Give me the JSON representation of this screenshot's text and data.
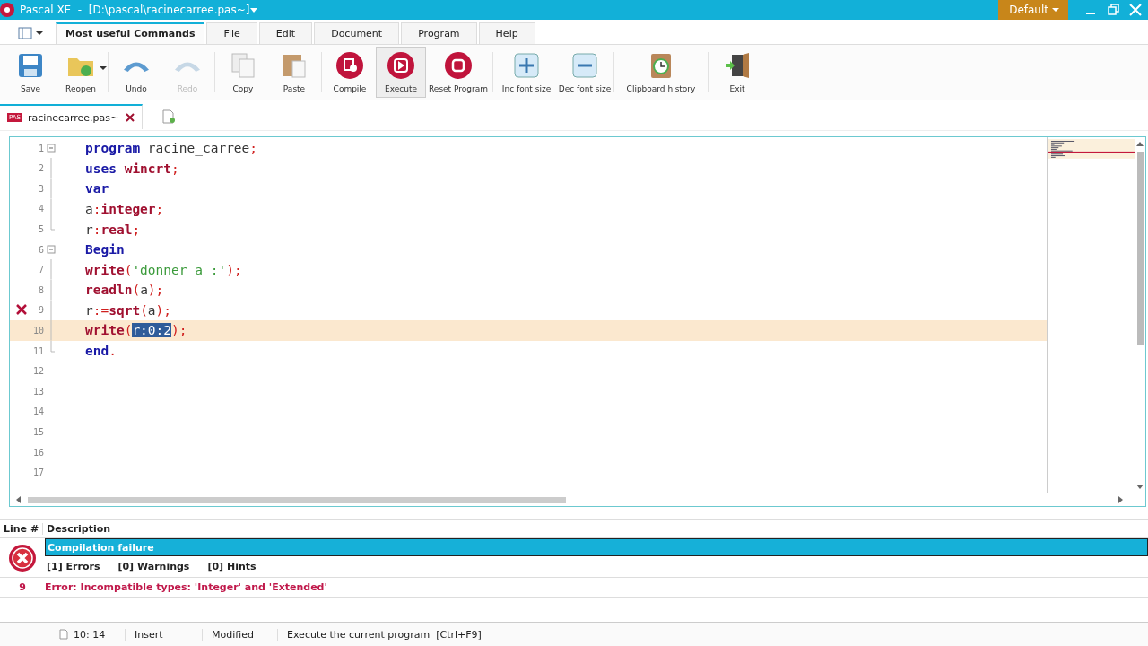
{
  "window": {
    "title": "Pascal XE  -  [D:\\pascal\\racinecarree.pas~]",
    "layout": "Default"
  },
  "ribbon_tabs": [
    {
      "label": "Most useful Commands",
      "selected": true
    },
    {
      "label": "File",
      "selected": false
    },
    {
      "label": "Edit",
      "selected": false
    },
    {
      "label": "Document",
      "selected": false
    },
    {
      "label": "Program",
      "selected": false
    },
    {
      "label": "Help",
      "selected": false
    }
  ],
  "toolbar_groups": [
    [
      {
        "label": "Save",
        "kind": "save",
        "disabled": false,
        "hovered": false,
        "menu": false
      },
      {
        "label": "Reopen",
        "kind": "folder",
        "disabled": false,
        "hovered": false,
        "menu": true
      }
    ],
    [
      {
        "label": "Undo",
        "kind": "undo",
        "disabled": false,
        "hovered": false,
        "menu": false
      },
      {
        "label": "Redo",
        "kind": "redo",
        "disabled": true,
        "hovered": false,
        "menu": false
      }
    ],
    [
      {
        "label": "Copy",
        "kind": "copy",
        "disabled": false,
        "hovered": false,
        "menu": false
      },
      {
        "label": "Paste",
        "kind": "paste",
        "disabled": false,
        "hovered": false,
        "menu": false
      }
    ],
    [
      {
        "label": "Compile",
        "kind": "compile",
        "disabled": false,
        "hovered": false,
        "menu": false
      },
      {
        "label": "Execute",
        "kind": "execute",
        "disabled": false,
        "hovered": true,
        "menu": false
      },
      {
        "label": "Reset Program",
        "kind": "stop",
        "disabled": false,
        "hovered": false,
        "menu": false
      }
    ],
    [
      {
        "label": "Inc font size",
        "kind": "plus",
        "disabled": false,
        "hovered": false,
        "menu": false
      },
      {
        "label": "Dec font size",
        "kind": "minus",
        "disabled": false,
        "hovered": false,
        "menu": false
      }
    ],
    [
      {
        "label": "Clipboard history",
        "kind": "clipboard",
        "disabled": false,
        "hovered": false,
        "menu": false
      }
    ],
    [
      {
        "label": "Exit",
        "kind": "exit",
        "disabled": false,
        "hovered": false,
        "menu": false
      }
    ]
  ],
  "documents": [
    {
      "badge": "PAS",
      "name": "racinecarree.pas~",
      "selected": true
    }
  ],
  "editor": {
    "lines": [
      {
        "number": "1",
        "kind": "fold_start",
        "error": false,
        "current": false,
        "tokens": [
          {
            "t": "program",
            "kind": "keyword"
          },
          {
            "t": " racine_carree",
            "kind": "ident"
          },
          {
            "t": ";",
            "kind": "punct"
          }
        ]
      },
      {
        "number": "2",
        "kind": "block",
        "error": false,
        "current": false,
        "tokens": [
          {
            "t": "uses",
            "kind": "keyword"
          },
          {
            "t": " wincrt",
            "kind": "builtin"
          },
          {
            "t": ";",
            "kind": "punct"
          }
        ]
      },
      {
        "number": "3",
        "kind": "block",
        "error": false,
        "current": false,
        "tokens": [
          {
            "t": "var",
            "kind": "keyword"
          }
        ]
      },
      {
        "number": "4",
        "kind": "block",
        "error": false,
        "current": false,
        "tokens": [
          {
            "t": "a",
            "kind": "ident"
          },
          {
            "t": ":",
            "kind": "punct"
          },
          {
            "t": "integer",
            "kind": "builtin"
          },
          {
            "t": ";",
            "kind": "punct"
          }
        ]
      },
      {
        "number": "5",
        "kind": "block_end",
        "error": false,
        "current": false,
        "tokens": [
          {
            "t": "r",
            "kind": "ident"
          },
          {
            "t": ":",
            "kind": "punct"
          },
          {
            "t": "real",
            "kind": "builtin"
          },
          {
            "t": ";",
            "kind": "punct"
          }
        ]
      },
      {
        "number": "6",
        "kind": "fold_start",
        "error": false,
        "current": false,
        "tokens": [
          {
            "t": "Begin",
            "kind": "keyword"
          }
        ]
      },
      {
        "number": "7",
        "kind": "block",
        "error": false,
        "current": false,
        "tokens": [
          {
            "t": "write",
            "kind": "builtin"
          },
          {
            "t": "(",
            "kind": "punct"
          },
          {
            "t": "'donner a :'",
            "kind": "string"
          },
          {
            "t": ");",
            "kind": "punct"
          }
        ]
      },
      {
        "number": "8",
        "kind": "block",
        "error": false,
        "current": false,
        "tokens": [
          {
            "t": "readln",
            "kind": "builtin"
          },
          {
            "t": "(",
            "kind": "punct"
          },
          {
            "t": "a",
            "kind": "ident"
          },
          {
            "t": ");",
            "kind": "punct"
          }
        ]
      },
      {
        "number": "9",
        "kind": "block",
        "error": true,
        "current": false,
        "tokens": [
          {
            "t": "r",
            "kind": "ident"
          },
          {
            "t": ":=",
            "kind": "punct"
          },
          {
            "t": "sqrt",
            "kind": "builtin"
          },
          {
            "t": "(",
            "kind": "punct"
          },
          {
            "t": "a",
            "kind": "ident"
          },
          {
            "t": ");",
            "kind": "punct"
          }
        ]
      },
      {
        "number": "10",
        "kind": "block",
        "error": false,
        "current": true,
        "tokens": [
          {
            "t": "write",
            "kind": "builtin"
          },
          {
            "t": "(",
            "kind": "punct"
          },
          {
            "t": "r:0:2",
            "kind": "selection"
          },
          {
            "t": ");",
            "kind": "punct"
          }
        ]
      },
      {
        "number": "11",
        "kind": "block_end",
        "error": false,
        "current": false,
        "tokens": [
          {
            "t": "end",
            "kind": "keyword"
          },
          {
            "t": ".",
            "kind": "punct"
          }
        ]
      },
      {
        "number": "12",
        "kind": "plain",
        "error": false,
        "current": false
      },
      {
        "number": "13",
        "kind": "plain",
        "error": false,
        "current": false
      },
      {
        "number": "14",
        "kind": "plain",
        "error": false,
        "current": false
      },
      {
        "number": "15",
        "kind": "plain",
        "error": false,
        "current": false
      },
      {
        "number": "16",
        "kind": "plain",
        "error": false,
        "current": false
      },
      {
        "number": "17",
        "kind": "plain",
        "error": false,
        "current": false
      }
    ]
  },
  "messages": {
    "columns": [
      "Line #",
      "Description"
    ],
    "summary": {
      "title": "Compilation failure",
      "counts": [
        "[1] Errors",
        "[0] Warnings",
        "[0] Hints"
      ]
    },
    "rows": [
      {
        "line": "9",
        "text": "Error: Incompatible types: 'Integer' and 'Extended'"
      }
    ]
  },
  "status_bar": {
    "position": "10: 14",
    "mode": "Insert",
    "state": "Modified",
    "hint": "Execute the current program  [Ctrl+F9]"
  }
}
